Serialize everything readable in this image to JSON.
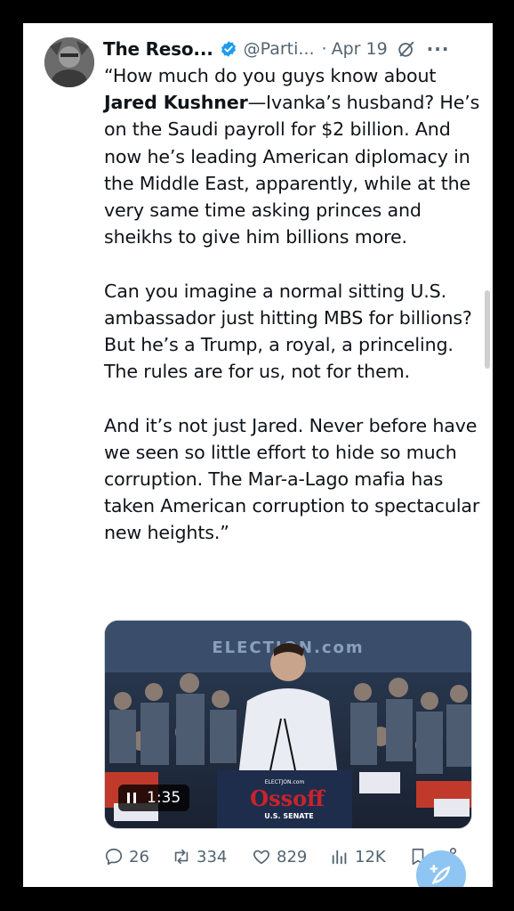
{
  "tweet": {
    "display_name": "The Reso...",
    "handle": "@Parti...",
    "separator": "·",
    "date": "Apr 19",
    "more": "···",
    "text_p1_before": "“How much do you guys know about ",
    "text_p1_bold": "Jared Kushner",
    "text_p1_after": "—Ivanka’s husband? He’s on the Saudi payroll for $2 billion. And now he’s leading American diplomacy in the Middle East, apparently, while at the very same time asking princes and sheikhs to give him billions more.",
    "text_p2": "Can you imagine a normal sitting U.S. ambassador just hitting MBS for billions? But he’s a Trump, a royal, a princeling. The rules are for us, not for them.",
    "text_p3": "And it’s not just Jared. Never before have we seen so little effort to hide so much corruption. The Mar-a-Lago mafia has taken American corruption to spectacular new heights.”"
  },
  "video": {
    "duration": "1:35",
    "backdrop_text": "ELECTJON.com",
    "podium_small": "ELECTJON.com",
    "podium_name": "Ossoff",
    "podium_sub": "U.S. SENATE",
    "podium_name_color": "#c8242b"
  },
  "actions": {
    "replies": "26",
    "reposts": "334",
    "likes": "829",
    "views": "12K"
  },
  "colors": {
    "verified": "#1d9bf0",
    "muted": "#536471",
    "fab": "#8ec5f2"
  }
}
